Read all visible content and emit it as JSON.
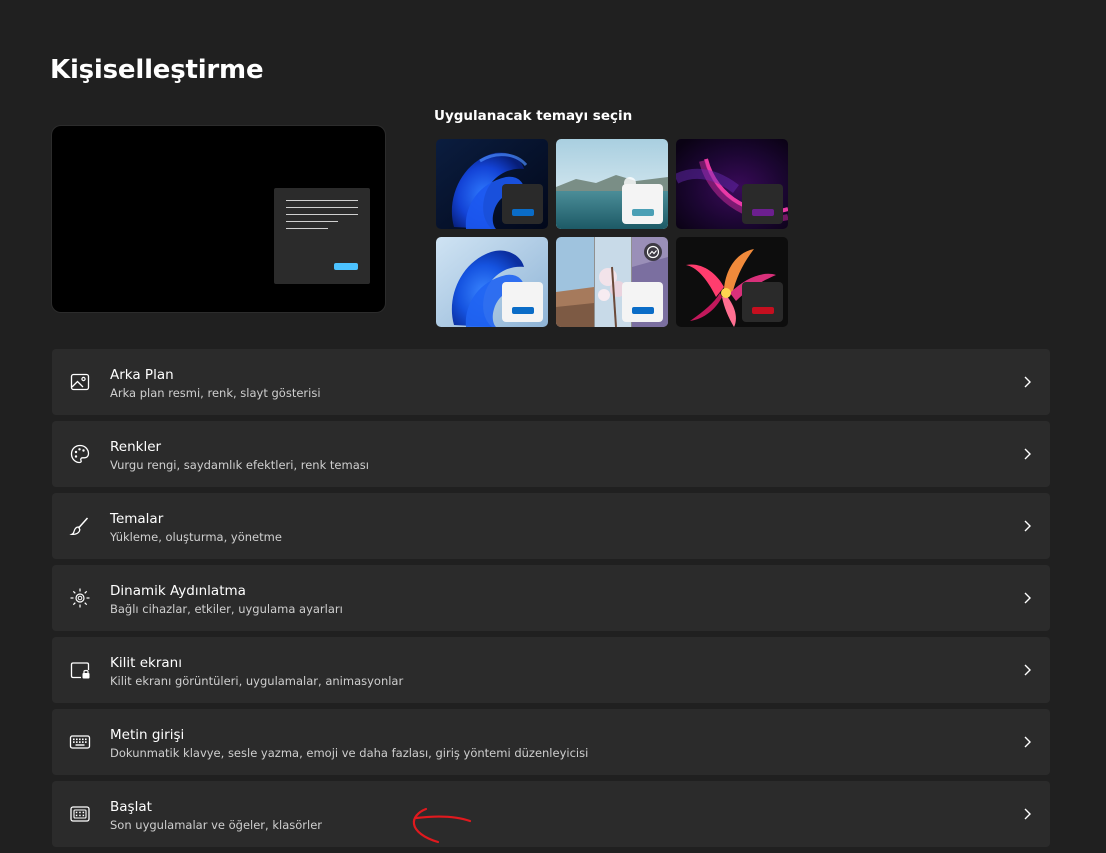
{
  "page": {
    "title": "Kişiselleştirme"
  },
  "theme_picker": {
    "heading": "Uygulanacak temayı seçin",
    "themes": [
      {
        "icon": "windows-bloom-dark-theme",
        "accent": "#0a6cc7"
      },
      {
        "icon": "glow-lake-theme",
        "accent": "#4a9fb5"
      },
      {
        "icon": "purple-flow-theme",
        "accent": "#6c1f8f"
      },
      {
        "icon": "windows-bloom-light-theme",
        "accent": "#0a6cc7"
      },
      {
        "icon": "spotlight-slideshow-theme",
        "accent": "#0a6cc7"
      },
      {
        "icon": "captured-motion-flower-theme",
        "accent": "#c50f1f"
      }
    ]
  },
  "settings": [
    {
      "icon": "picture-icon",
      "title": "Arka Plan",
      "description": "Arka plan resmi, renk, slayt gösterisi"
    },
    {
      "icon": "palette-icon",
      "title": "Renkler",
      "description": "Vurgu rengi, saydamlık efektleri, renk teması"
    },
    {
      "icon": "paintbrush-icon",
      "title": "Temalar",
      "description": "Yükleme, oluşturma, yönetme"
    },
    {
      "icon": "sun-icon",
      "title": "Dinamik Aydınlatma",
      "description": "Bağlı cihazlar, etkiler, uygulama ayarları"
    },
    {
      "icon": "lock-screen-icon",
      "title": "Kilit ekranı",
      "description": "Kilit ekranı görüntüleri, uygulamalar, animasyonlar"
    },
    {
      "icon": "keyboard-icon",
      "title": "Metin girişi",
      "description": "Dokunmatik klavye, sesle yazma, emoji ve daha fazlası, giriş yöntemi düzenleyicisi"
    },
    {
      "icon": "start-menu-icon",
      "title": "Başlat",
      "description": "Son uygulamalar ve öğeler, klasörler"
    }
  ],
  "colors": {
    "background": "#202020",
    "card": "#2b2b2b",
    "accent_preview": "#4cc2ff",
    "annotation": "#e0191e"
  }
}
